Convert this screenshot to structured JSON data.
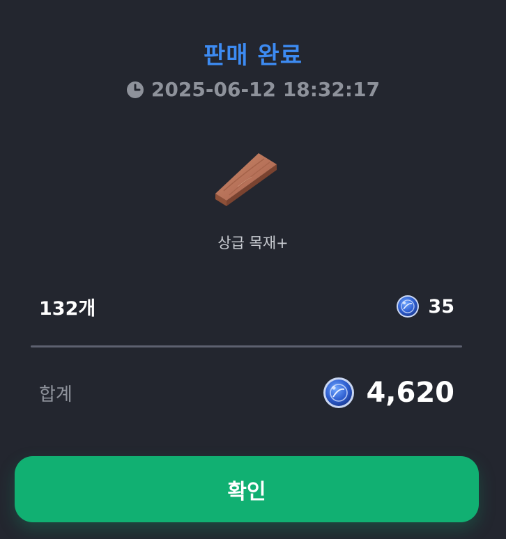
{
  "header": {
    "title": "판매 완료",
    "timestamp": "2025-06-12 18:32:17",
    "clock_icon": "clock-icon"
  },
  "item": {
    "name": "상급 목재+",
    "image_icon": "wooden-plank-icon"
  },
  "quantity_row": {
    "quantity": "132개",
    "unit_price": "35",
    "currency_icon": "blue-coin-icon"
  },
  "total_row": {
    "label": "합계",
    "value": "4,620",
    "currency_icon": "blue-coin-icon"
  },
  "actions": {
    "confirm_label": "확인"
  },
  "colors": {
    "background": "#23262f",
    "title_blue": "#3d8bf2",
    "muted_text": "#8e929b",
    "confirm_green": "#11b072",
    "divider": "#5d6170"
  }
}
